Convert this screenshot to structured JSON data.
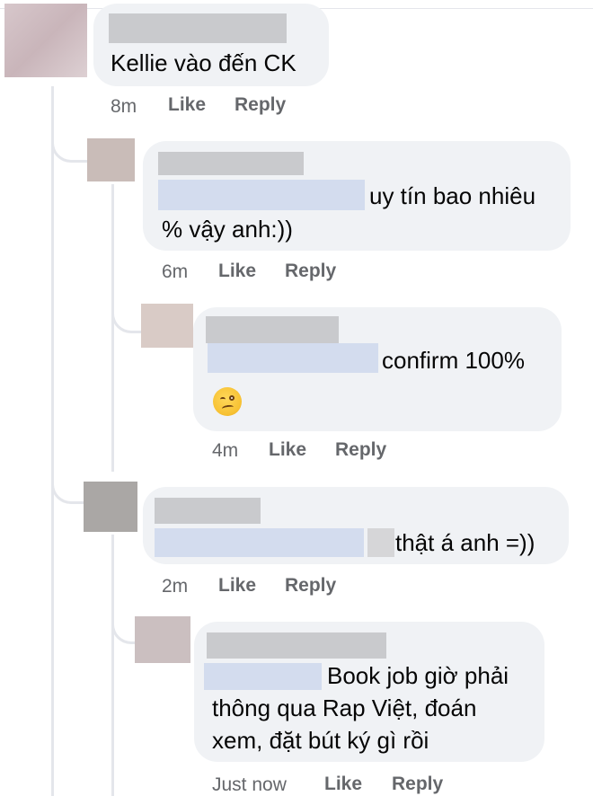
{
  "comments": [
    {
      "text": "Kellie vào đến CK",
      "time": "8m",
      "like": "Like",
      "reply": "Reply"
    },
    {
      "text_line1": "uy tín bao nhiêu",
      "text_line2": "% vậy anh:))",
      "time": "6m",
      "like": "Like",
      "reply": "Reply"
    },
    {
      "text": "confirm 100%",
      "emoji": "woozy-face",
      "time": "4m",
      "like": "Like",
      "reply": "Reply"
    },
    {
      "text": "thật á anh =))",
      "time": "2m",
      "like": "Like",
      "reply": "Reply"
    },
    {
      "text_line1": "Book job giờ phải",
      "text_line2": "thông qua Rap Việt, đoán",
      "text_line3": "xem, đặt bút ký gì rồi",
      "time": "Just now",
      "like": "Like",
      "reply": "Reply"
    }
  ],
  "colors": {
    "bubble": "#f0f2f5",
    "meta": "#65676b",
    "text": "#050505",
    "thread_line": "#e4e6eb",
    "redaction_name": "#c9cacd",
    "redaction_tag": "#d3dcee"
  }
}
